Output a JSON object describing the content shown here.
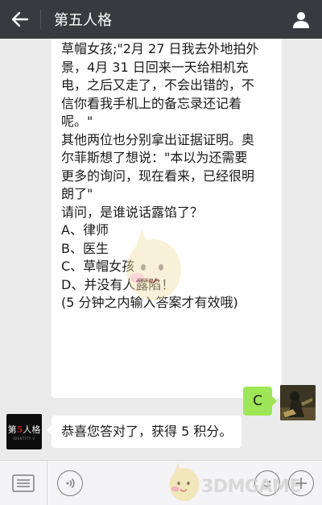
{
  "header": {
    "title": "第五人格",
    "back_icon": "arrow-left-icon",
    "profile_icon": "person-icon",
    "background": "#393a3f"
  },
  "messages": {
    "long_message_lines": [
      "草帽女孩;\"2月 27 日我去外地拍外",
      "景，4月 31 日回来一天给相机充",
      "电，之后又走了，不会出错的，不",
      "信你看我手机上的备忘录还记着",
      "呢。\"",
      "其他两位也分别拿出证据证明。奥",
      "尔菲斯想了想说：\"本以为还需要",
      "更多的询问，现在看来，已经很明",
      "朗了\"",
      "请问，是谁说话露馅了？",
      "A、律师",
      "B、医生",
      "C、草帽女孩",
      "D、并没有人露陷！",
      "(5 分钟之内输入答案才有效哦)"
    ],
    "user_reply": "C",
    "bot_reply": "恭喜您答对了，获得 5 积分。"
  },
  "avatars": {
    "game_logo_main_a": "第",
    "game_logo_main_b": "5",
    "game_logo_main_c": "人格",
    "game_logo_sub": "IDENTITY V"
  },
  "bottombar": {
    "menu_icon": "menu-list-icon",
    "voice_icon": "voice-icon",
    "emoji_icon": "emoji-icon",
    "plus_icon": "plus-icon"
  },
  "watermark": {
    "brand": "3DMGAME"
  },
  "colors": {
    "outgoing_bubble": "#9fe657",
    "incoming_bubble": "#ffffff",
    "chat_background": "#ebebeb"
  }
}
